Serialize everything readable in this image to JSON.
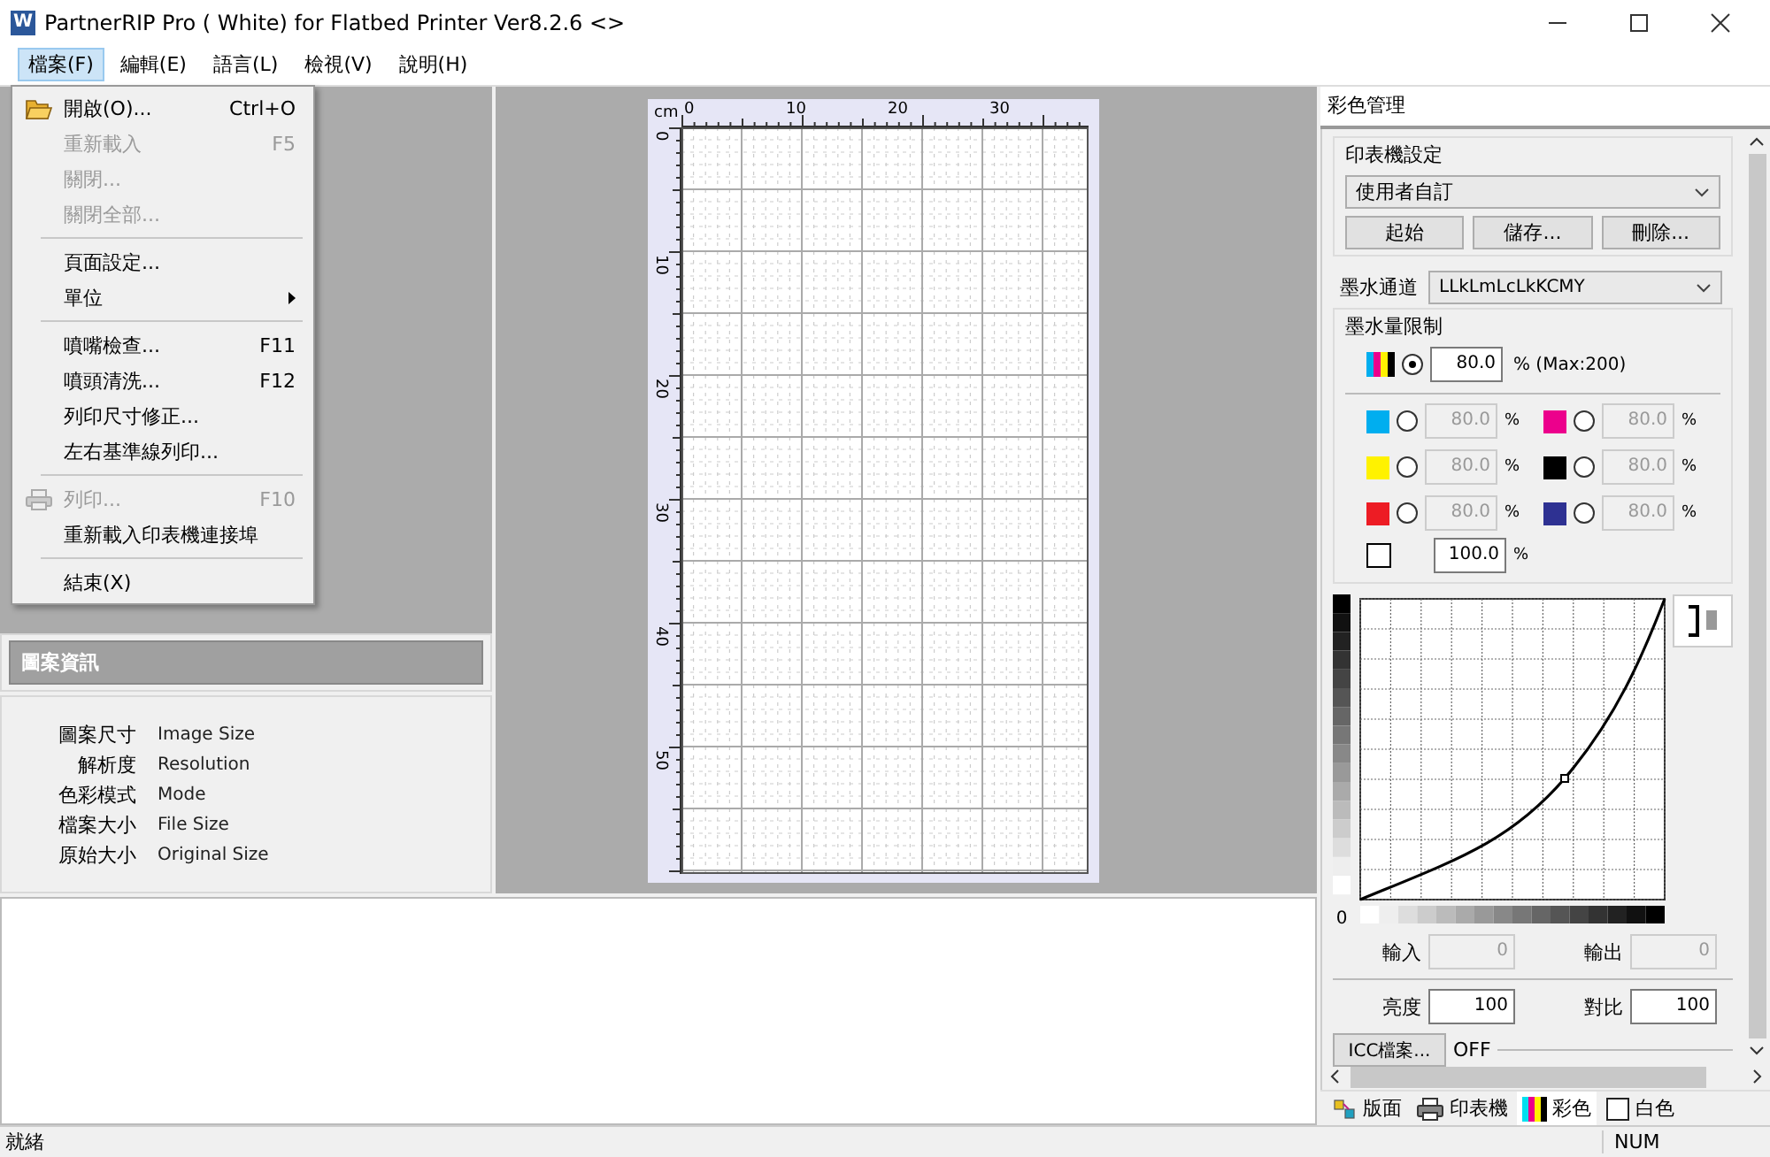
{
  "window": {
    "title": "PartnerRIP Pro ( White) for Flatbed Printer Ver8.2.6 <>",
    "app_icon_letter": "W"
  },
  "menubar": [
    {
      "label": "檔案(F)",
      "selected": true
    },
    {
      "label": "編輯(E)",
      "selected": false
    },
    {
      "label": "語言(L)",
      "selected": false
    },
    {
      "label": "檢視(V)",
      "selected": false
    },
    {
      "label": "說明(H)",
      "selected": false
    }
  ],
  "file_menu": [
    {
      "kind": "item",
      "label": "開啟(O)...",
      "shortcut": "Ctrl+O",
      "disabled": false
    },
    {
      "kind": "item",
      "label": "重新載入",
      "shortcut": "F5",
      "disabled": true
    },
    {
      "kind": "item",
      "label": "關閉...",
      "disabled": true
    },
    {
      "kind": "item",
      "label": "關閉全部...",
      "disabled": true
    },
    {
      "kind": "separator"
    },
    {
      "kind": "item",
      "label": "頁面設定...",
      "disabled": false
    },
    {
      "kind": "submenu",
      "label": "單位",
      "disabled": false
    },
    {
      "kind": "separator"
    },
    {
      "kind": "item",
      "label": "噴嘴檢查...",
      "shortcut": "F11",
      "disabled": false
    },
    {
      "kind": "item",
      "label": "噴頭清洗...",
      "shortcut": "F12",
      "disabled": false
    },
    {
      "kind": "item",
      "label": "列印尺寸修正...",
      "disabled": false
    },
    {
      "kind": "item",
      "label": "左右基準線列印...",
      "disabled": false
    },
    {
      "kind": "separator"
    },
    {
      "kind": "item",
      "label": "列印...",
      "shortcut": "F10",
      "disabled": true
    },
    {
      "kind": "item",
      "label": "重新載入印表機連接埠",
      "disabled": false
    },
    {
      "kind": "separator"
    },
    {
      "kind": "item",
      "label": "結束(X)",
      "disabled": false
    }
  ],
  "image_info": {
    "title": "圖案資訊",
    "rows": [
      {
        "label": "圖案尺寸",
        "value": "Image Size"
      },
      {
        "label": "解析度",
        "value": "Resolution"
      },
      {
        "label": "色彩模式",
        "value": "Mode"
      },
      {
        "label": "檔案大小",
        "value": "File Size"
      },
      {
        "label": "原始大小",
        "value": "Original Size"
      }
    ]
  },
  "ruler": {
    "unit": "cm",
    "x_labels": [
      "0",
      "10",
      "20",
      "30"
    ],
    "y_labels": [
      "0",
      "10",
      "20",
      "30",
      "40",
      "50"
    ]
  },
  "color_panel": {
    "title": "彩色管理",
    "printer_settings": {
      "label": "印表機設定",
      "preset": "使用者自訂",
      "buttons": [
        "起始",
        "儲存...",
        "刪除..."
      ]
    },
    "ink_channel": {
      "label": "墨水通道",
      "value": "LLkLmLcLkKCMY"
    },
    "ink_limit": {
      "label": "墨水量限制",
      "total": {
        "selected": true,
        "value": "80.0",
        "unit": "% (Max:200)"
      },
      "channels": [
        {
          "color": "#00aeef",
          "selected": false,
          "value": "80.0",
          "disabled": true,
          "unit": "%"
        },
        {
          "color": "#ec008c",
          "selected": false,
          "value": "80.0",
          "disabled": true,
          "unit": "%"
        },
        {
          "color": "#fff200",
          "selected": false,
          "value": "80.0",
          "disabled": true,
          "unit": "%"
        },
        {
          "color": "#000000",
          "selected": false,
          "value": "80.0",
          "disabled": true,
          "unit": "%"
        },
        {
          "color": "#ed1c24",
          "selected": false,
          "value": "80.0",
          "disabled": true,
          "unit": "%"
        },
        {
          "color": "#2e3192",
          "selected": false,
          "value": "80.0",
          "disabled": true,
          "unit": "%"
        }
      ],
      "white": {
        "value": "100.0",
        "unit": "%"
      }
    },
    "curve": {
      "zero_label": "0",
      "input_label": "輸入",
      "input_value": "0",
      "output_label": "輸出",
      "output_value": "0"
    },
    "brightness": {
      "label": "亮度",
      "value": "100"
    },
    "contrast": {
      "label": "對比",
      "value": "100"
    },
    "icc": {
      "button": "ICC檔案...",
      "status": "OFF"
    }
  },
  "tabs": [
    {
      "label": "版面",
      "selected": false
    },
    {
      "label": "印表機",
      "selected": false
    },
    {
      "label": "彩色",
      "selected": true
    },
    {
      "label": "白色",
      "selected": false
    }
  ],
  "status_bar": {
    "text": "就緒",
    "indicator": "NUM"
  }
}
